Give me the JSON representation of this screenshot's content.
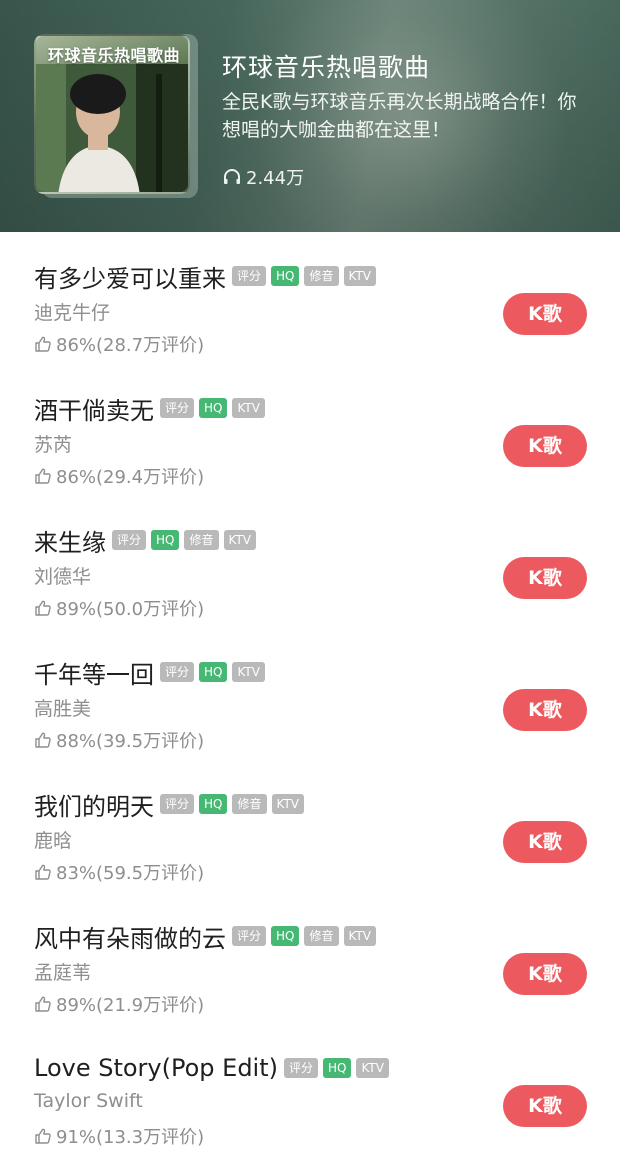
{
  "header": {
    "cover_title": "环球音乐热唱歌曲",
    "title": "环球音乐热唱歌曲",
    "description": "全民K歌与环球音乐再次长期战略合作！你想唱的大咖金曲都在这里！",
    "play_count": "2.44万",
    "play_icon": "headphone-icon"
  },
  "colors": {
    "accent_button": "#ec5a5f",
    "hq_tag": "#47b874",
    "gray_tag": "#b9b9b9",
    "header_bg": "#4a6b5f"
  },
  "songs": [
    {
      "name": "有多少爱可以重来",
      "singer": "迪克牛仔",
      "rating": "86%(28.7万评价)",
      "tags": [
        "评分",
        "HQ",
        "修音",
        "KTV"
      ],
      "button": "K歌"
    },
    {
      "name": "酒干倘卖无",
      "singer": "苏芮",
      "rating": "86%(29.4万评价)",
      "tags": [
        "评分",
        "HQ",
        "KTV"
      ],
      "button": "K歌"
    },
    {
      "name": "来生缘",
      "singer": "刘德华",
      "rating": "89%(50.0万评价)",
      "tags": [
        "评分",
        "HQ",
        "修音",
        "KTV"
      ],
      "button": "K歌"
    },
    {
      "name": "千年等一回",
      "singer": "高胜美",
      "rating": "88%(39.5万评价)",
      "tags": [
        "评分",
        "HQ",
        "KTV"
      ],
      "button": "K歌"
    },
    {
      "name": "我们的明天",
      "singer": "鹿晗",
      "rating": "83%(59.5万评价)",
      "tags": [
        "评分",
        "HQ",
        "修音",
        "KTV"
      ],
      "button": "K歌"
    },
    {
      "name": "风中有朵雨做的云",
      "singer": "孟庭苇",
      "rating": "89%(21.9万评价)",
      "tags": [
        "评分",
        "HQ",
        "修音",
        "KTV"
      ],
      "button": "K歌"
    },
    {
      "name": "Love Story(Pop Edit)",
      "singer": "Taylor Swift",
      "rating": "91%(13.3万评价)",
      "tags": [
        "评分",
        "HQ",
        "KTV"
      ],
      "button": "K歌"
    }
  ]
}
